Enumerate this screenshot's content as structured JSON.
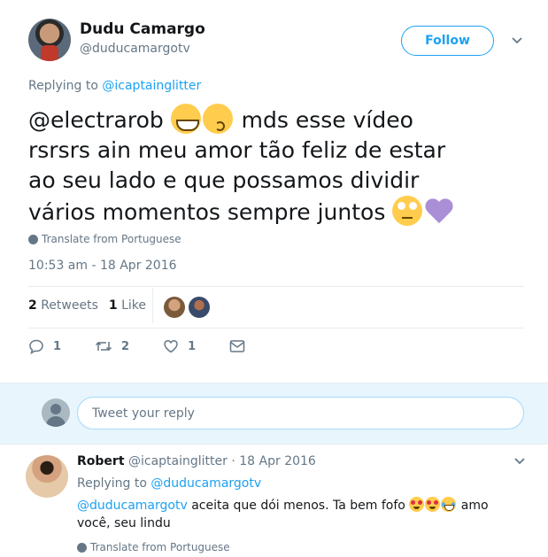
{
  "tweet": {
    "author": {
      "name": "Dudu Camargo",
      "handle": "@duducamargotv"
    },
    "follow_label": "Follow",
    "replying_prefix": "Replying to",
    "replying_to": "@icaptainglitter",
    "text": {
      "mention": "@electrarob",
      "line1_rest": " mds esse vídeo",
      "line2": "rsrsrs ain meu amor tão feliz de estar",
      "line3": "ao seu lado e que possamos dividir",
      "line4": "vários momentos sempre juntos"
    },
    "emojis": {
      "after_mention": [
        "grinning-face-emoji",
        "kissing-face-emoji"
      ],
      "end": [
        "rolling-eyes-emoji",
        "purple-heart-emoji"
      ]
    },
    "translate_label": "Translate from Portuguese",
    "timestamp": "10:53 am - 18 Apr 2016",
    "stats": {
      "retweets_count": "2",
      "retweets_label": "Retweets",
      "likes_count": "1",
      "likes_label": "Like"
    },
    "actions": {
      "reply_count": "1",
      "retweet_count": "2",
      "like_count": "1"
    }
  },
  "reply_box": {
    "placeholder": "Tweet your reply"
  },
  "reply": {
    "author_name": "Robert",
    "handle": "@icaptainglitter",
    "separator": "·",
    "date": "18 Apr 2016",
    "replying_prefix": "Replying to",
    "replying_to": "@duducamargotv",
    "mention": "@duducamargotv",
    "text_part1": " aceita que dói menos. Ta bem fofo ",
    "text_part2": " amo",
    "text_line2": "você, seu lindu",
    "emojis": [
      "heart-eyes-emoji",
      "heart-eyes-emoji",
      "joy-emoji"
    ],
    "translate_label": "Translate from Portuguese"
  },
  "colors": {
    "accent": "#1da1f2",
    "muted": "#657786",
    "reply_bar_bg": "#e8f5fd"
  }
}
